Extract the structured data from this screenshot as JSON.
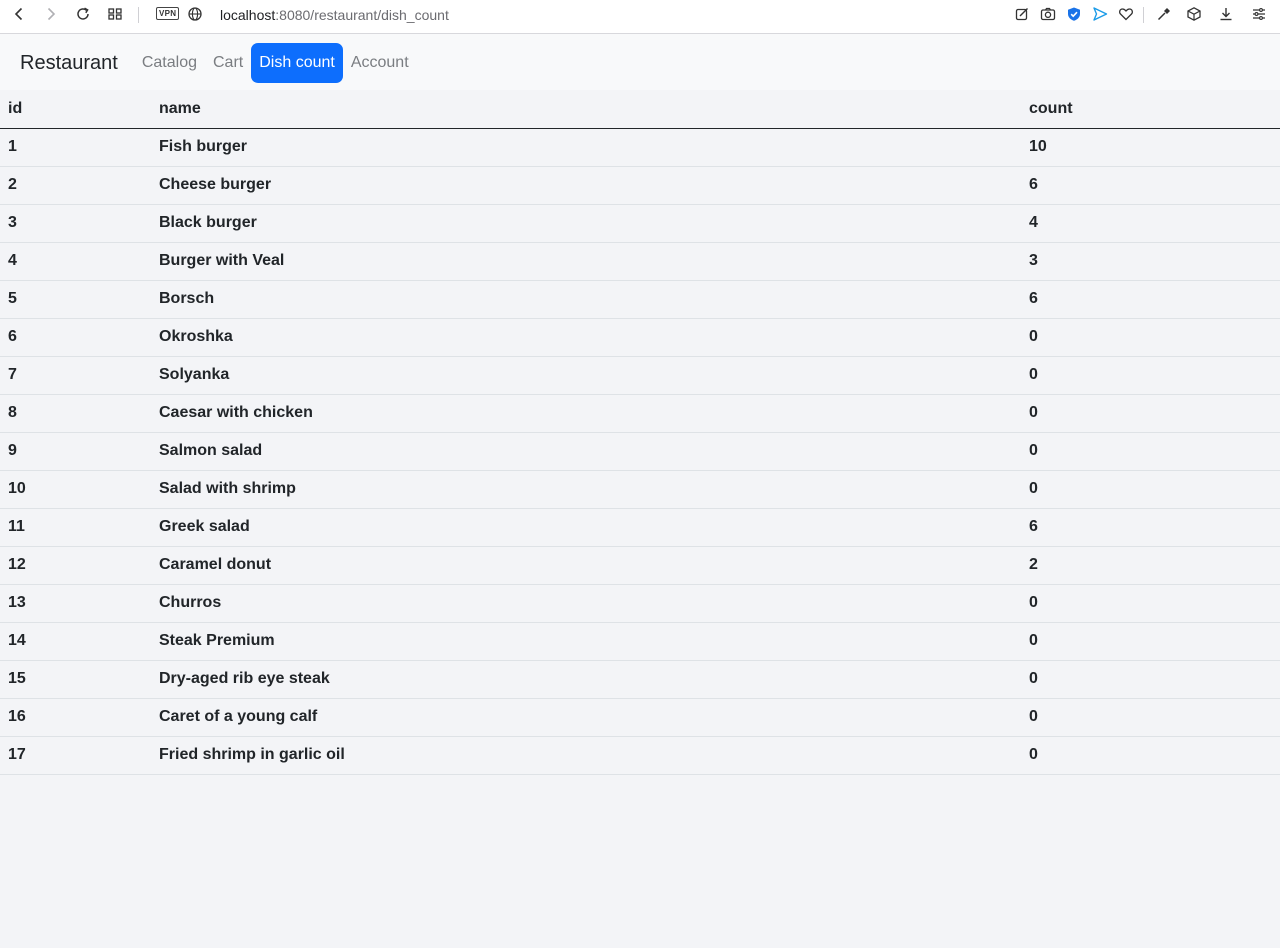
{
  "browser": {
    "vpn_label": "VPN",
    "url_host": "localhost",
    "url_path": ":8080/restaurant/dish_count"
  },
  "navbar": {
    "brand": "Restaurant",
    "links": [
      {
        "label": "Catalog",
        "active": false
      },
      {
        "label": "Cart",
        "active": false
      },
      {
        "label": "Dish count",
        "active": true
      },
      {
        "label": "Account",
        "active": false
      }
    ]
  },
  "table": {
    "headers": [
      "id",
      "name",
      "count"
    ],
    "rows": [
      {
        "id": "1",
        "name": "Fish burger",
        "count": "10"
      },
      {
        "id": "2",
        "name": "Cheese burger",
        "count": "6"
      },
      {
        "id": "3",
        "name": "Black burger",
        "count": "4"
      },
      {
        "id": "4",
        "name": "Burger with Veal",
        "count": "3"
      },
      {
        "id": "5",
        "name": "Borsch",
        "count": "6"
      },
      {
        "id": "6",
        "name": "Okroshka",
        "count": "0"
      },
      {
        "id": "7",
        "name": "Solyanka",
        "count": "0"
      },
      {
        "id": "8",
        "name": "Caesar with chicken",
        "count": "0"
      },
      {
        "id": "9",
        "name": "Salmon salad",
        "count": "0"
      },
      {
        "id": "10",
        "name": "Salad with shrimp",
        "count": "0"
      },
      {
        "id": "11",
        "name": "Greek salad",
        "count": "6"
      },
      {
        "id": "12",
        "name": "Caramel donut",
        "count": "2"
      },
      {
        "id": "13",
        "name": "Churros",
        "count": "0"
      },
      {
        "id": "14",
        "name": "Steak Premium",
        "count": "0"
      },
      {
        "id": "15",
        "name": "Dry-aged rib eye steak",
        "count": "0"
      },
      {
        "id": "16",
        "name": "Caret of a young calf",
        "count": "0"
      },
      {
        "id": "17",
        "name": "Fried shrimp in garlic oil",
        "count": "0"
      }
    ]
  },
  "colors": {
    "accent": "#0d6efd",
    "page_bg": "#f3f4f7",
    "navbar_bg": "#f8f9fa"
  }
}
